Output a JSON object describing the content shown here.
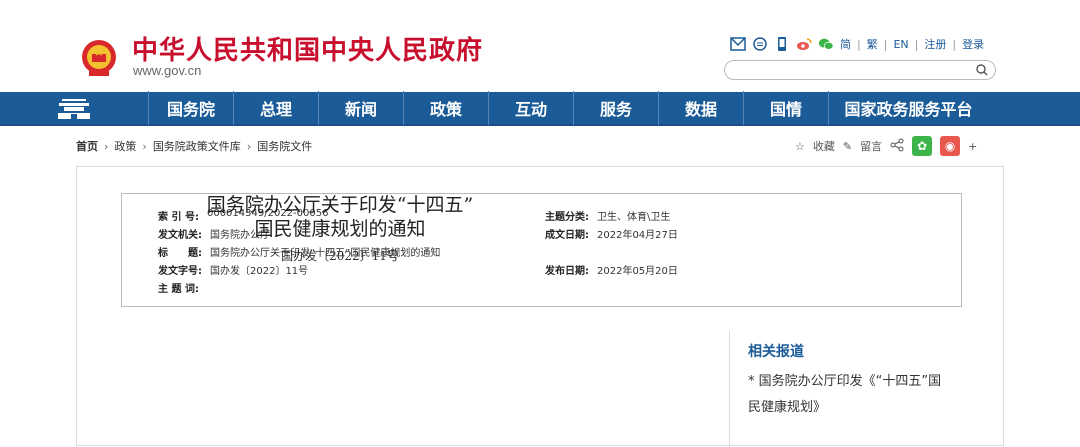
{
  "site": {
    "title": "中华人民共和国中央人民政府",
    "url": "www.gov.cn"
  },
  "tools": {
    "simplified": "简",
    "traditional": "繁",
    "english": "EN",
    "register": "注册",
    "login": "登录"
  },
  "search": {
    "placeholder": ""
  },
  "nav": {
    "items": [
      "国务院",
      "总理",
      "新闻",
      "政策",
      "互动",
      "服务",
      "数据",
      "国情",
      "国家政务服务平台"
    ]
  },
  "breadcrumb": {
    "home": "首页",
    "items": [
      "政策",
      "国务院政策文件库",
      "国务院文件"
    ]
  },
  "share": {
    "favorite": "收藏",
    "comment": "留言",
    "plus": "+"
  },
  "meta": {
    "index_label": "索 引 号:",
    "index_value": "000014349/2022-00056",
    "topic_label": "主题分类:",
    "topic_value": "卫生、体育\\卫生",
    "issuer_label": "发文机关:",
    "issuer_value": "国务院办公厅",
    "created_label": "成文日期:",
    "created_value": "2022年04月27日",
    "title_label": "标　　题:",
    "title_value": "国务院办公厅关于印发“十四五”国民健康规划的通知",
    "doc_label": "发文字号:",
    "doc_value": "国办发〔2022〕11号",
    "published_label": "发布日期:",
    "published_value": "2022年05月20日",
    "keywords_label": "主 题 词:",
    "keywords_value": ""
  },
  "article": {
    "title_line1": "国务院办公厅关于印发“十四五”",
    "title_line2": "国民健康规划的通知",
    "doc_number": "国办发〔2022〕11号"
  },
  "related": {
    "title": "相关报道",
    "items": [
      "* 国务院办公厅印发《“十四五”国民健康规划》"
    ]
  },
  "colors": {
    "brand_red": "#c8102e",
    "nav_blue": "#1b5b98",
    "wechat_green": "#3bb549",
    "weibo_red": "#e9584f"
  }
}
